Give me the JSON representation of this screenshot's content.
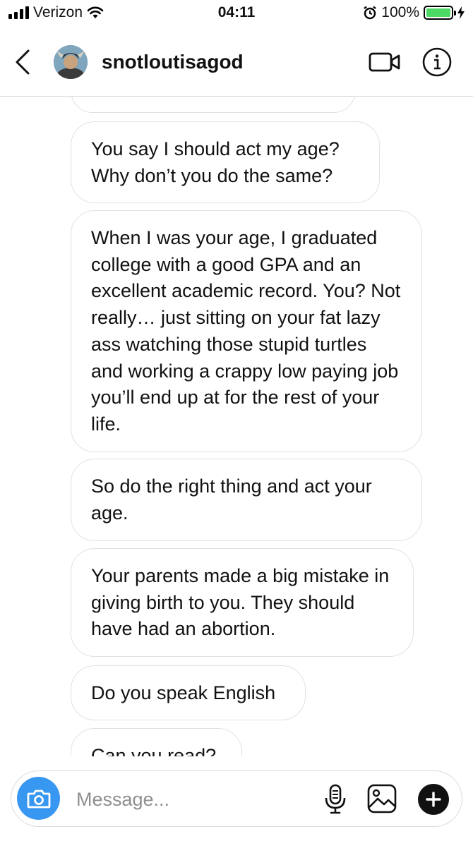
{
  "status_bar": {
    "carrier": "Verizon",
    "time": "04:11",
    "battery_percent": "100%",
    "battery_level": 1.0,
    "battery_color": "#4cd964",
    "icons": [
      "signal-icon",
      "wifi-icon",
      "alarm-icon",
      "battery-icon",
      "charging-icon"
    ]
  },
  "header": {
    "username": "snotloutisagod",
    "icons": [
      "back-chevron-icon",
      "avatar",
      "video-call-icon",
      "info-icon"
    ]
  },
  "messages": [
    {
      "text": ""
    },
    {
      "text": "You say I should act my age? Why don’t you do the same?"
    },
    {
      "text": "When I was your age, I graduated college with a good GPA and an excellent academic record. You? Not really… just sitting on your fat lazy ass watching those stupid turtles and working a crappy low paying job you’ll end up at for the rest of your life."
    },
    {
      "text": "So do the right thing and act your age."
    },
    {
      "text": "Your parents made a big mistake in giving birth to you. They should have had an abortion."
    },
    {
      "text": "Do you speak English"
    },
    {
      "text": "Can you read?"
    }
  ],
  "composer": {
    "placeholder": "Message...",
    "accent_color": "#3897f0",
    "icons": [
      "camera-icon",
      "microphone-icon",
      "gallery-icon",
      "plus-icon"
    ]
  }
}
